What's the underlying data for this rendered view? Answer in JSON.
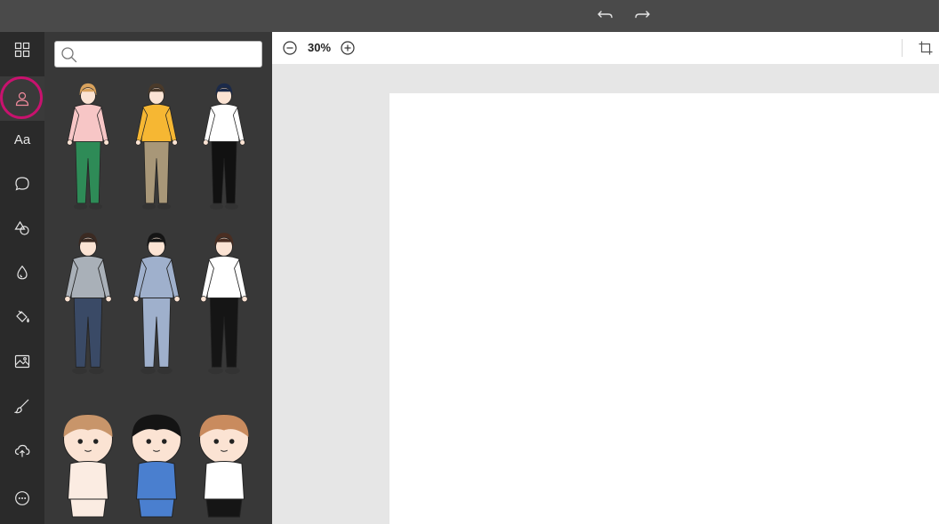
{
  "toolbar": {
    "zoom_level": "30%",
    "icons": [
      "undo-icon",
      "redo-icon",
      "zoom-out-icon",
      "zoom-in-icon",
      "crop-icon"
    ]
  },
  "sidebar": {
    "active_item": "characters",
    "items": [
      {
        "id": "templates",
        "icon": "grid-icon"
      },
      {
        "id": "characters",
        "icon": "person-icon"
      },
      {
        "id": "text",
        "icon": "text-icon",
        "label": "Aa"
      },
      {
        "id": "speech-bubbles",
        "icon": "speech-bubble-icon"
      },
      {
        "id": "shapes",
        "icon": "shapes-icon"
      },
      {
        "id": "effects",
        "icon": "drop-icon"
      },
      {
        "id": "fill",
        "icon": "paint-bucket-icon"
      },
      {
        "id": "images",
        "icon": "image-icon"
      },
      {
        "id": "brush",
        "icon": "brush-icon"
      },
      {
        "id": "upload",
        "icon": "upload-cloud-icon"
      },
      {
        "id": "more",
        "icon": "more-icon"
      }
    ]
  },
  "search": {
    "value": "",
    "placeholder": ""
  },
  "characters": [
    {
      "name": "boy-pink-shirt",
      "colors": {
        "top": "#f7c6c6",
        "bottom": "#2e8b57",
        "hair": "#d9a25c"
      }
    },
    {
      "name": "boy-yellow-shirt",
      "colors": {
        "top": "#f6b733",
        "bottom": "#a89778",
        "hair": "#4a3a2a"
      }
    },
    {
      "name": "man-white-shirt-tie",
      "colors": {
        "top": "#ffffff",
        "bottom": "#111111",
        "hair": "#1b2a4a"
      }
    },
    {
      "name": "worker-gray-uniform",
      "colors": {
        "top": "#a9b0b8",
        "bottom": "#3a4a66",
        "hair": "#3b2a22"
      }
    },
    {
      "name": "woman-blue-uniform",
      "colors": {
        "top": "#9fb0cc",
        "bottom": "#9fb0cc",
        "hair": "#141414"
      }
    },
    {
      "name": "man-white-shirt-black-pants",
      "colors": {
        "top": "#ffffff",
        "bottom": "#151515",
        "hair": "#4a2e22"
      }
    },
    {
      "name": "chibi-pale",
      "colors": {
        "top": "#fbece2",
        "bottom": "#fbece2",
        "hair": "#c8956a"
      }
    },
    {
      "name": "chibi-blue-overalls",
      "colors": {
        "top": "#4a7fcf",
        "bottom": "#4a7fcf",
        "hair": "#141414"
      }
    },
    {
      "name": "chibi-sprout",
      "colors": {
        "top": "#ffffff",
        "bottom": "#151515",
        "hair": "#c98b5e"
      }
    }
  ]
}
